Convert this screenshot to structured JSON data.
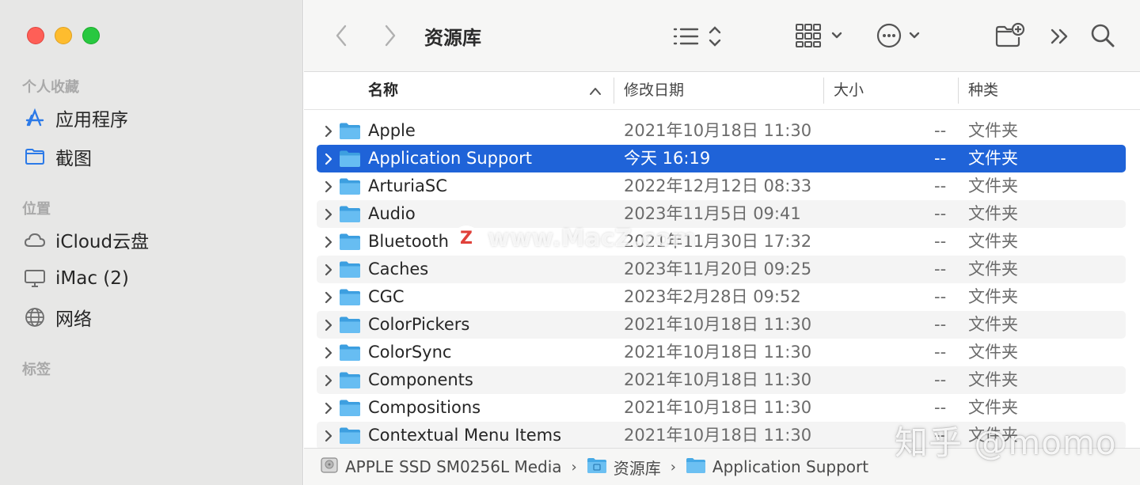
{
  "sidebar": {
    "sections": [
      {
        "title": "个人收藏",
        "items": [
          {
            "label": "应用程序",
            "icon": "applications-icon"
          },
          {
            "label": "截图",
            "icon": "folder-icon"
          }
        ]
      },
      {
        "title": "位置",
        "items": [
          {
            "label": "iCloud云盘",
            "icon": "cloud-icon"
          },
          {
            "label": "iMac (2)",
            "icon": "display-icon"
          },
          {
            "label": "网络",
            "icon": "globe-icon"
          }
        ]
      },
      {
        "title": "标签",
        "items": []
      }
    ]
  },
  "toolbar": {
    "title": "资源库",
    "icons": [
      "back-icon",
      "forward-icon",
      "list-view-icon",
      "group-view-icon",
      "more-actions-icon",
      "new-folder-icon",
      "overflow-icon",
      "search-icon"
    ]
  },
  "columns": {
    "name": "名称",
    "date": "修改日期",
    "size": "大小",
    "kind": "种类"
  },
  "rows": [
    {
      "name": "Apple",
      "date": "2021年10月18日 11:30",
      "size": "--",
      "kind": "文件夹"
    },
    {
      "name": "Application Support",
      "date": "今天 16:19",
      "size": "--",
      "kind": "文件夹",
      "selected": true
    },
    {
      "name": "ArturiaSC",
      "date": "2022年12月12日 08:33",
      "size": "--",
      "kind": "文件夹"
    },
    {
      "name": "Audio",
      "date": "2023年11月5日 09:41",
      "size": "--",
      "kind": "文件夹"
    },
    {
      "name": "Bluetooth",
      "date": "2021年11月30日 17:32",
      "size": "--",
      "kind": "文件夹"
    },
    {
      "name": "Caches",
      "date": "2023年11月20日 09:25",
      "size": "--",
      "kind": "文件夹"
    },
    {
      "name": "CGC",
      "date": "2023年2月28日 09:52",
      "size": "--",
      "kind": "文件夹"
    },
    {
      "name": "ColorPickers",
      "date": "2021年10月18日 11:30",
      "size": "--",
      "kind": "文件夹"
    },
    {
      "name": "ColorSync",
      "date": "2021年10月18日 11:30",
      "size": "--",
      "kind": "文件夹"
    },
    {
      "name": "Components",
      "date": "2021年10月18日 11:30",
      "size": "--",
      "kind": "文件夹"
    },
    {
      "name": "Compositions",
      "date": "2021年10月18日 11:30",
      "size": "--",
      "kind": "文件夹"
    },
    {
      "name": "Contextual Menu Items",
      "date": "2021年10月18日 11:30",
      "size": "--",
      "kind": "文件夹"
    }
  ],
  "pathbar": {
    "segments": [
      {
        "label": "APPLE SSD SM0256L Media",
        "icon": "disk-icon"
      },
      {
        "label": "资源库",
        "icon": "library-folder-icon"
      },
      {
        "label": "Application Support",
        "icon": "folder-icon"
      }
    ],
    "separator": "›"
  },
  "watermarks": {
    "center_logo": "Z",
    "center_text": "www.MacZ.com",
    "corner_text": "知乎 @momo"
  },
  "colors": {
    "selection": "#1f63d8",
    "folder": "#46a9e6",
    "accent": "#2c7ae8",
    "close": "#fe5f57",
    "minimize": "#febc2e",
    "zoom": "#28c840"
  }
}
